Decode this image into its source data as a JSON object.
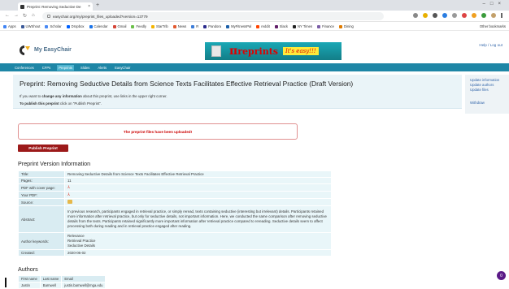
{
  "browser": {
    "tab_title": "Preprint: Removing Seductive De",
    "url": "easychair.org/my/preprint_files_uploaded?version=13779",
    "bookmarks": [
      "Apps",
      "UWShout",
      "Scholar",
      "Dropbox",
      "Calendar",
      "Gmail",
      "Feedly",
      "StarTrib",
      "News",
      "R",
      "Pandora",
      "MyFitnessPal",
      "reddit",
      "Slack",
      "NY Times",
      "Finance",
      "Dining"
    ],
    "other_bookmarks": "Other bookmarks"
  },
  "header": {
    "logo_text": "My EasyChair",
    "banner_pi": "π",
    "banner_text": "reprints",
    "banner_tagline": "It's easy!!!",
    "help_links": "Help / Log out"
  },
  "menu": [
    "Conferences",
    "CFPs",
    "Preprints",
    "Slides",
    "Alerts",
    "EasyChair"
  ],
  "menu_active_index": 2,
  "page": {
    "title": "Preprint: Removing Seductive Details from Science Texts Facilitates Effective Retrieval Practice (Draft Version)",
    "hint1_pre": "If you want to ",
    "hint1_bold": "change any information",
    "hint1_post": " about this preprint, use links in the upper right corner.",
    "hint2_bold": "To publish this preprint",
    "hint2_post": " click on \"Publish Preprint\".",
    "notice": "The preprint files have been uploaded!",
    "publish_button": "Publish Preprint",
    "version_heading": "Preprint Version Information",
    "authors_heading": "Authors"
  },
  "sidebar": {
    "links": [
      "Update information",
      "Update authors",
      "Update files"
    ],
    "withdraw": "Withdraw"
  },
  "info": {
    "title_k": "Title:",
    "title_v": "Removing Seductive Details from Science Texts Facilitates Effective Retrieval Practice",
    "pages_k": "Pages:",
    "pages_v": "11",
    "pdfcover_k": "PDF with cover page:",
    "yourpdf_k": "Your PDF:",
    "source_k": "Source:",
    "abstract_k": "Abstract:",
    "abstract_v": "In previous research, participants engaged in retrieval practice, or simply reread, texts containing seductive (interesting but irrelevant) details. Participants retained more information after retrieval practice, but only for seductive details, not important information. Here, we conducted the same comparison after removing seductive details from the texts. Participants retained significantly more important information after retrieval practice compared to rereading. Seductive details seem to affect processing both during reading and in retrieval practice engaged after reading.",
    "keywords_k": "Author keywords:",
    "keywords": [
      "Relevance",
      "Retrieval Practice",
      "Seductive Details"
    ],
    "created_k": "Created:",
    "created_v": "2020-06-02"
  },
  "authors": {
    "headers": [
      "First name",
      "Last name",
      "Email"
    ],
    "rows": [
      [
        "Justin",
        "Barnwell",
        "justin.barnwell@mga.edu"
      ]
    ]
  },
  "chat_label": "0",
  "colors": {
    "menubar": "#1e86a6",
    "publish_button": "#9c1a1a",
    "notice_text": "#cc0000",
    "table_key": "#d9ecf2",
    "table_value": "#e9f6f9"
  }
}
